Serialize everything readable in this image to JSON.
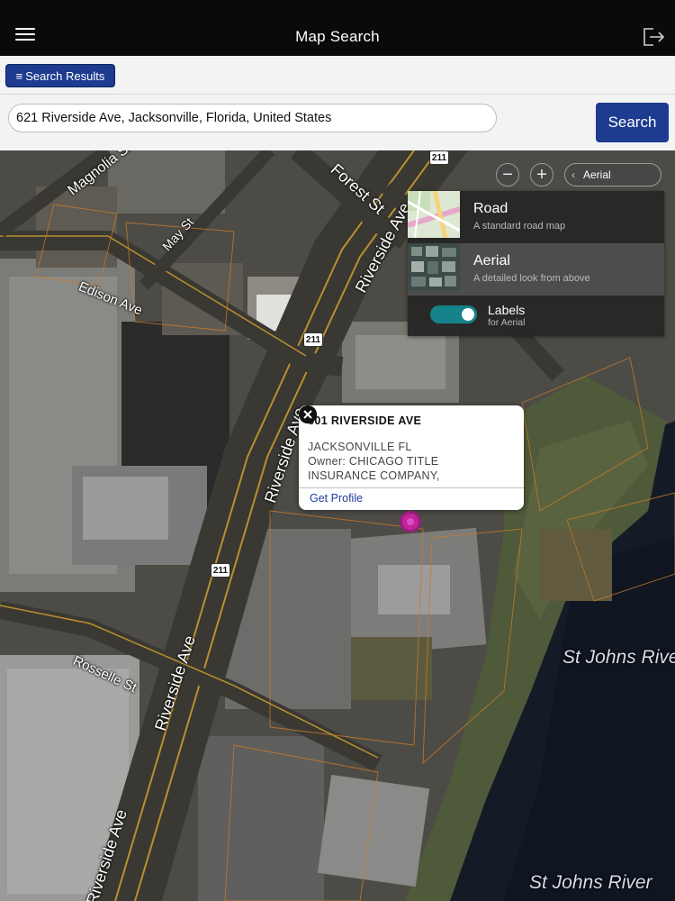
{
  "app": {
    "title": "Map Search"
  },
  "icons": {
    "menu": "hamburger-menu-icon",
    "logout": "logout-icon",
    "list": "list-icon",
    "close": "close-icon",
    "pin": "map-pin-icon"
  },
  "toolbar": {
    "results_label": "Search Results"
  },
  "search": {
    "value": "621 Riverside Ave, Jacksonville, Florida, United States",
    "button_label": "Search"
  },
  "map_controls": {
    "zoom_out": "−",
    "zoom_in": "+",
    "current_style": "Aerial",
    "styles": [
      {
        "name": "Road",
        "description": "A standard road map"
      },
      {
        "name": "Aerial",
        "description": "A detailed look from above"
      }
    ],
    "labels": {
      "name": "Labels",
      "description": "for Aerial",
      "enabled": true
    }
  },
  "popup": {
    "title": "601 RIVERSIDE AVE",
    "lines": [
      "JACKSONVILLE FL",
      "Owner: CHICAGO TITLE",
      "INSURANCE COMPANY,"
    ],
    "link_label": "Get Profile"
  },
  "map_labels": {
    "streets": [
      "Magnolia St",
      "Forest St",
      "May St",
      "Edison Ave",
      "Riverside Ave",
      "Rosselle St"
    ],
    "highway_shield": "211",
    "water": [
      "St Johns River"
    ]
  },
  "colors": {
    "topbar": "#0a0a0a",
    "brand_blue": "#1d3b8f",
    "toggle_on": "#16828a",
    "pin": "#c0269a",
    "link": "#1f3d99"
  }
}
